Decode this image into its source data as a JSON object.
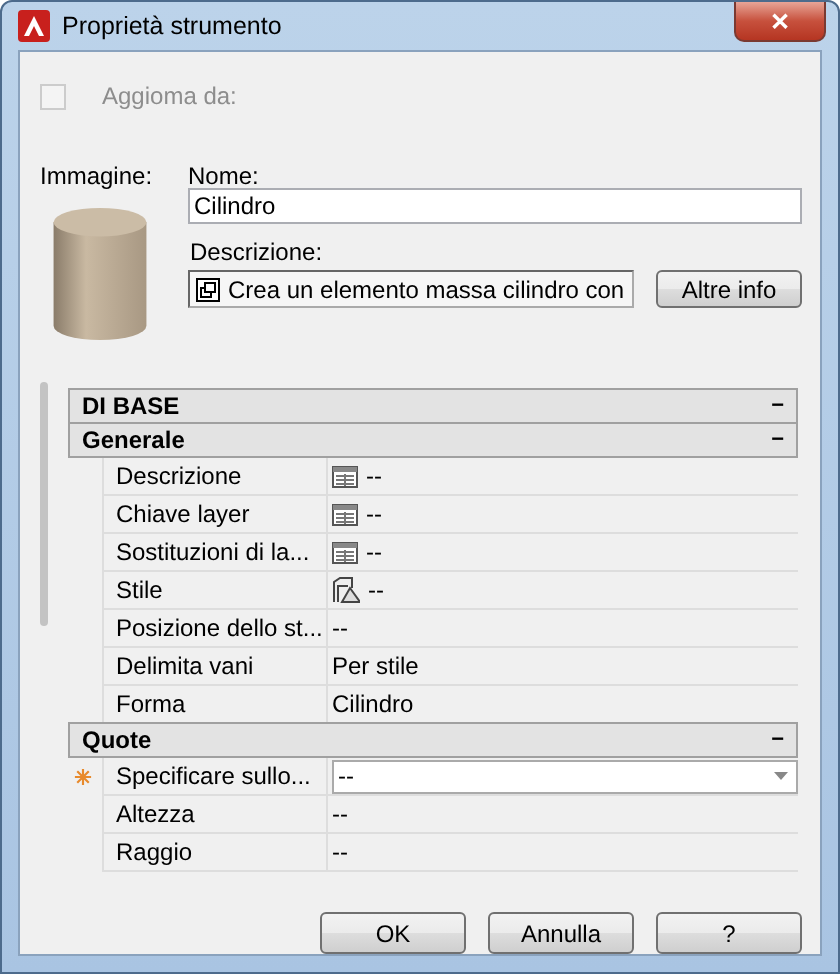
{
  "window": {
    "title": "Proprietà strumento",
    "close": "✕"
  },
  "update_from": {
    "label": "Aggioma da:",
    "checked": false,
    "disabled": true
  },
  "image_label": "Immagine:",
  "name": {
    "label": "Nome:",
    "value": "Cilindro"
  },
  "description": {
    "label": "Descrizione:",
    "value": "Crea un elemento massa cilindro con"
  },
  "more_info_button": "Altre info",
  "categories": [
    {
      "title": "DI BASE",
      "toggle": "−",
      "groups": [
        {
          "title": "Generale",
          "toggle": "−",
          "rows": [
            {
              "label": "Descrizione",
              "kind": "table",
              "value": "--",
              "required": false
            },
            {
              "label": "Chiave layer",
              "kind": "table",
              "value": "--",
              "required": false
            },
            {
              "label": "Sostituzioni di la...",
              "kind": "table",
              "value": "--",
              "required": false
            },
            {
              "label": "Stile",
              "kind": "style",
              "value": "--",
              "required": false
            },
            {
              "label": "Posizione dello st...",
              "kind": "text",
              "value": "--",
              "required": false
            },
            {
              "label": "Delimita vani",
              "kind": "text",
              "value": "Per stile",
              "required": false
            },
            {
              "label": "Forma",
              "kind": "text",
              "value": "Cilindro",
              "required": false
            }
          ]
        },
        {
          "title": "Quote",
          "toggle": "−",
          "rows": [
            {
              "label": "Specificare sullo...",
              "kind": "dropdown",
              "value": "--",
              "required": true
            },
            {
              "label": "Altezza",
              "kind": "text",
              "value": "--",
              "required": false
            },
            {
              "label": "Raggio",
              "kind": "text",
              "value": "--",
              "required": false
            }
          ]
        }
      ]
    }
  ],
  "buttons": [
    "OK",
    "Annulla",
    "?"
  ]
}
